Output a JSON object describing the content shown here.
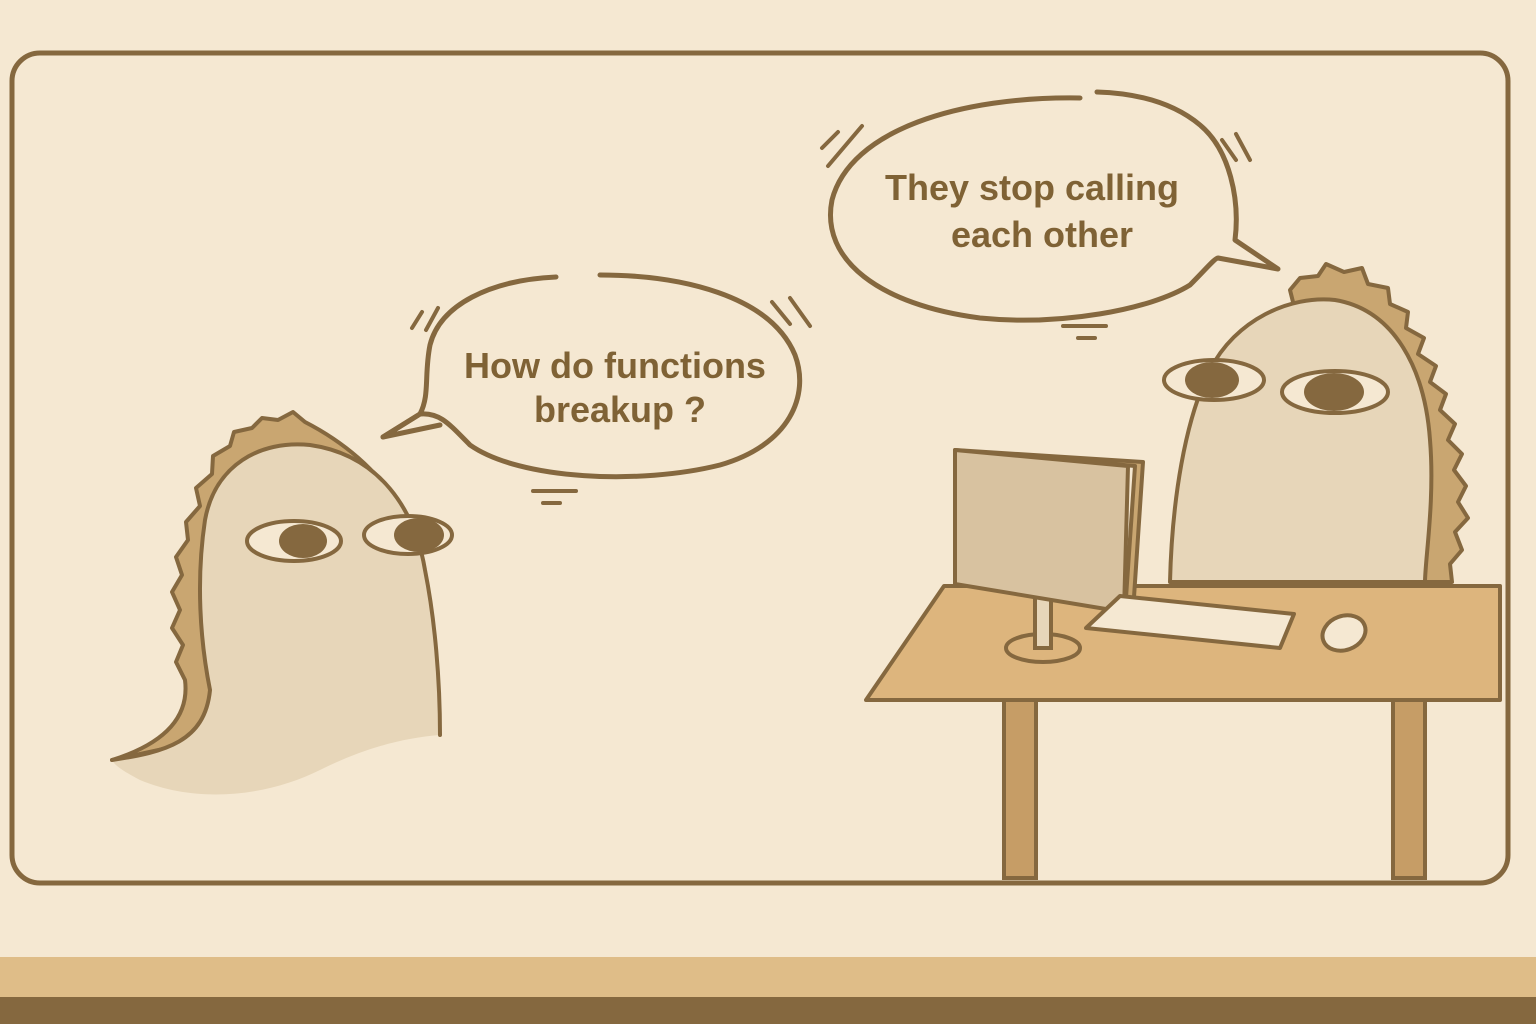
{
  "comic": {
    "left_bubble": {
      "line1": "How do functions",
      "line2": "breakup ?"
    },
    "right_bubble": {
      "line1": "They stop calling",
      "line2": "each other"
    }
  },
  "palette": {
    "background": "#f5e8d2",
    "outline": "#85683f",
    "text": "#7f6235",
    "creature_body": "#e7d6b9",
    "creature_spikes": "#c9a671",
    "desk_top": "#ddb57d",
    "desk_leg": "#c69d66",
    "monitor_screen": "#d8c2a0",
    "bottom_strip_light": "#dfbd88",
    "bottom_strip_dark": "#85683f",
    "pupil": "#85683f"
  },
  "icons": {
    "left_character": "ghost-dino-creature",
    "right_character": "ghost-dino-creature",
    "computer": "desktop-monitor-icon",
    "keyboard": "keyboard-icon",
    "mouse": "mouse-icon"
  }
}
